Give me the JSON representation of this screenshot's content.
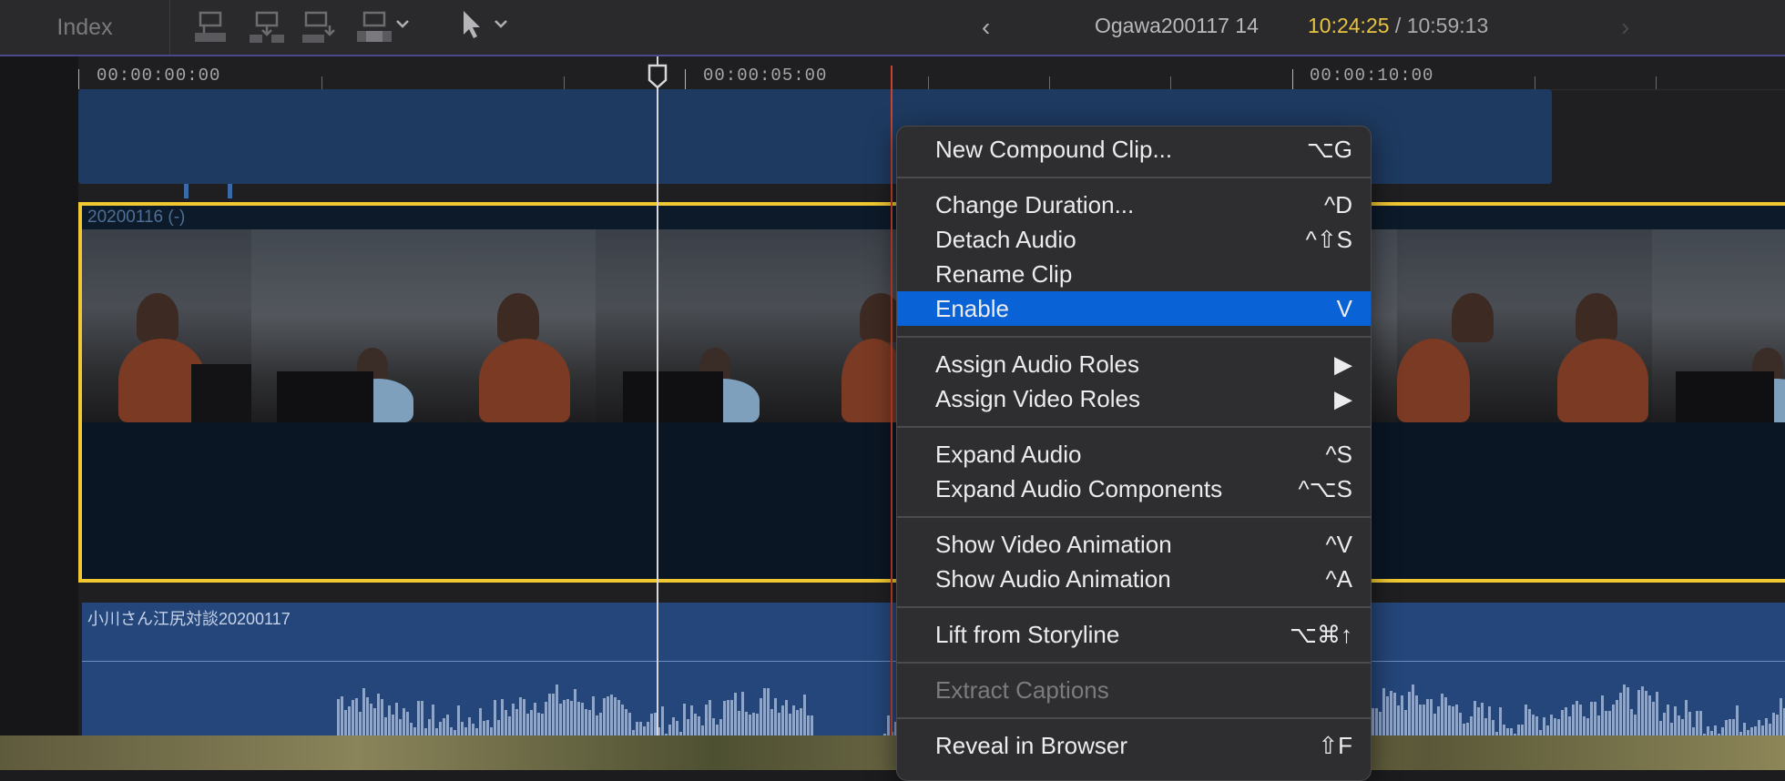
{
  "toolbar": {
    "index_label": "Index",
    "project_name": "Ogawa200117 14",
    "timecode_current": "10:24:25",
    "timecode_sep": " / ",
    "timecode_total": "10:59:13",
    "nav_prev": "‹",
    "nav_next": "›",
    "icons": [
      "connect-clip-icon",
      "insert-clip-icon",
      "append-clip-icon",
      "overwrite-clip-icon",
      "dropdown-chevron-icon",
      "select-tool-icon",
      "dropdown-chevron-icon"
    ]
  },
  "ruler": {
    "labels": [
      "00:00:00:00",
      "00:00:05:00",
      "00:00:10:00"
    ]
  },
  "clips": {
    "video_name": "20200116 (-)",
    "audio_name": "小川さん江尻対談20200117"
  },
  "context_menu": {
    "groups": [
      [
        {
          "label": "New Compound Clip...",
          "shortcut": "⌥G"
        }
      ],
      [
        {
          "label": "Change Duration...",
          "shortcut": "^D"
        },
        {
          "label": "Detach Audio",
          "shortcut": "^⇧S"
        },
        {
          "label": "Rename Clip",
          "shortcut": ""
        },
        {
          "label": "Enable",
          "shortcut": "V",
          "active": true
        }
      ],
      [
        {
          "label": "Assign Audio Roles",
          "shortcut": "▶"
        },
        {
          "label": "Assign Video Roles",
          "shortcut": "▶"
        }
      ],
      [
        {
          "label": "Expand Audio",
          "shortcut": "^S"
        },
        {
          "label": "Expand Audio Components",
          "shortcut": "^⌥S"
        }
      ],
      [
        {
          "label": "Show Video Animation",
          "shortcut": "^V"
        },
        {
          "label": "Show Audio Animation",
          "shortcut": "^A"
        }
      ],
      [
        {
          "label": "Lift from Storyline",
          "shortcut": "⌥⌘↑"
        }
      ],
      [
        {
          "label": "Extract Captions",
          "shortcut": "",
          "disabled": true
        }
      ],
      [
        {
          "label": "Reveal in Browser",
          "shortcut": "⇧F"
        }
      ]
    ]
  },
  "colors": {
    "accent_yellow": "#f1c832",
    "menu_highlight": "#0a63d6",
    "timecode_current": "#e8c440",
    "skimmer": "#c9442e"
  }
}
